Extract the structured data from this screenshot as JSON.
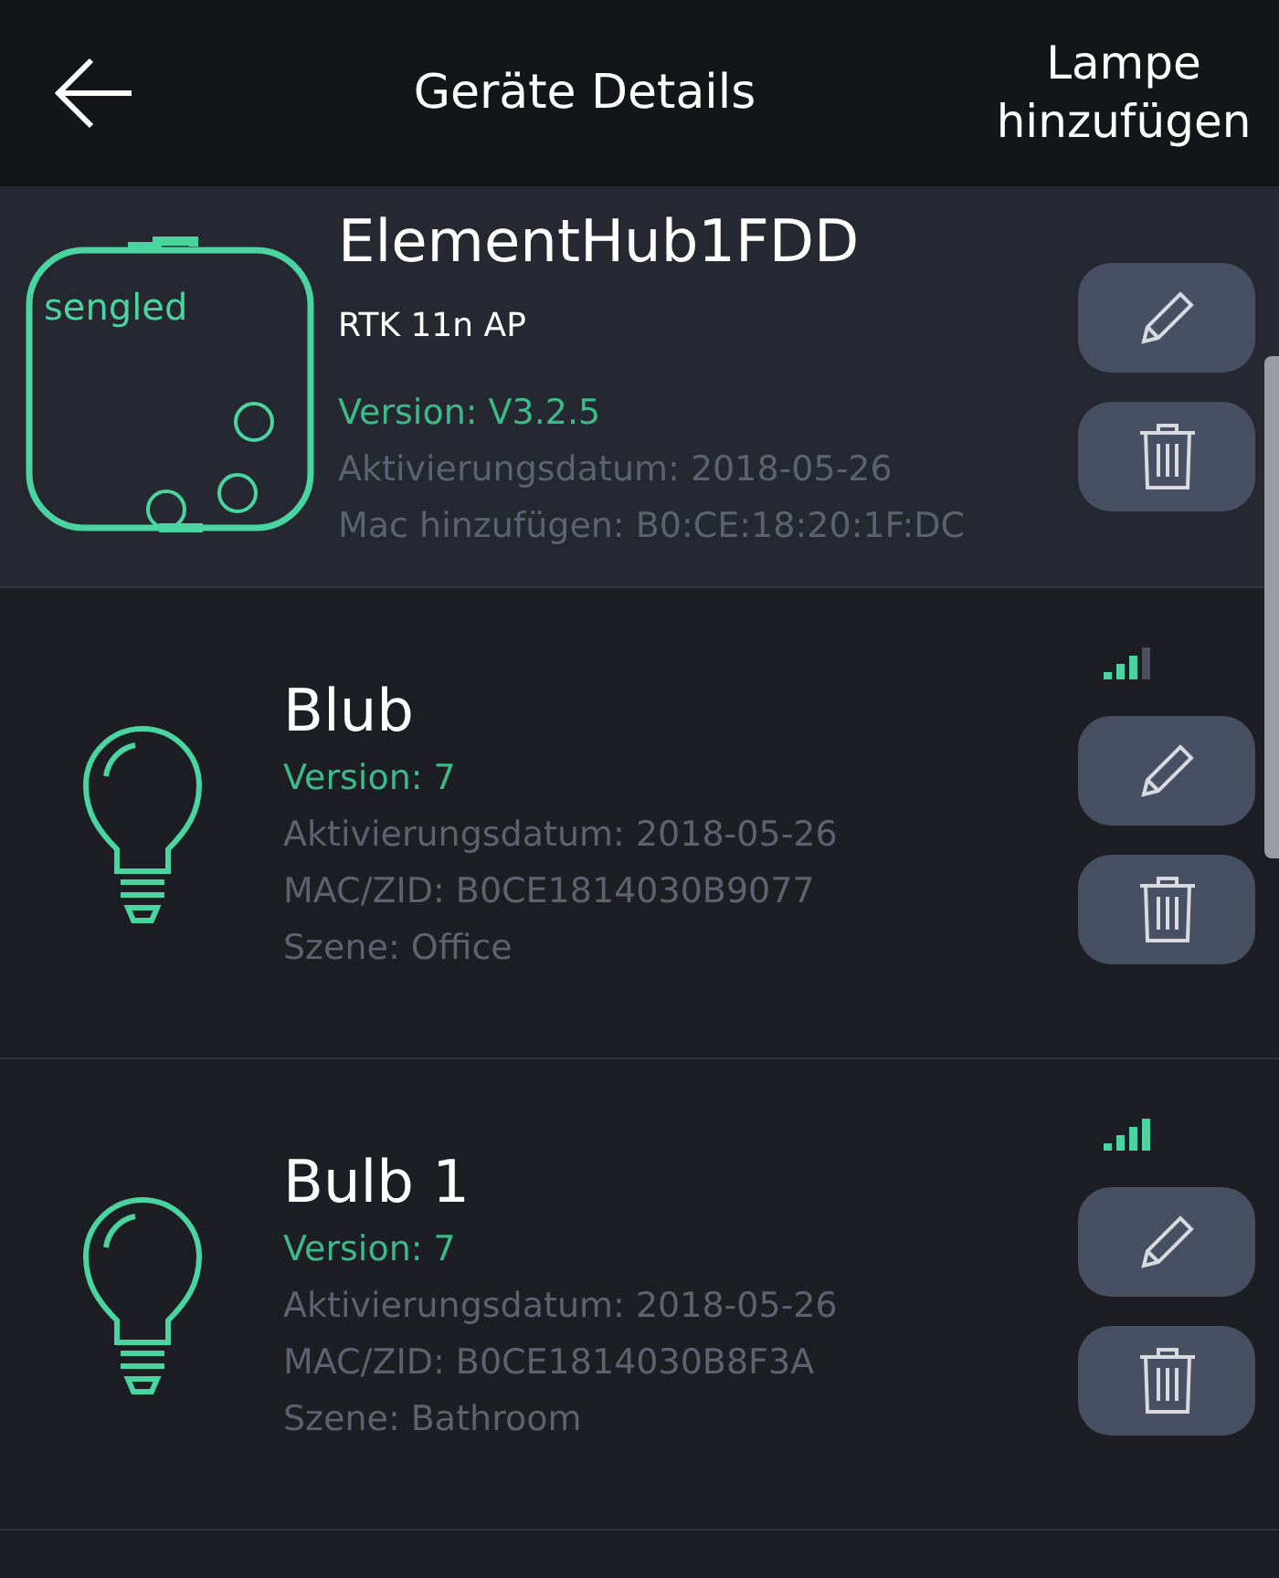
{
  "header": {
    "title": "Geräte Details",
    "action": "Lampe hinzufügen"
  },
  "hub": {
    "logo_text": "sengled",
    "name": "ElementHub1FDD",
    "model": "RTK 11n AP",
    "version": "Version: V3.2.5",
    "activation": "Aktivierungsdatum: 2018-05-26",
    "mac": "Mac hinzufügen: B0:CE:18:20:1F:DC"
  },
  "devices": [
    {
      "name": "Blub",
      "full_signal": false,
      "version": "Version: 7",
      "activation": "Aktivierungsdatum: 2018-05-26",
      "mac": "MAC/ZID: B0CE1814030B9077",
      "scene": "Szene: Office"
    },
    {
      "name": "Bulb 1",
      "full_signal": true,
      "version": "Version: 7",
      "activation": "Aktivierungsdatum: 2018-05-26",
      "mac": "MAC/ZID: B0CE1814030B8F3A",
      "scene": "Szene: Bathroom"
    }
  ]
}
